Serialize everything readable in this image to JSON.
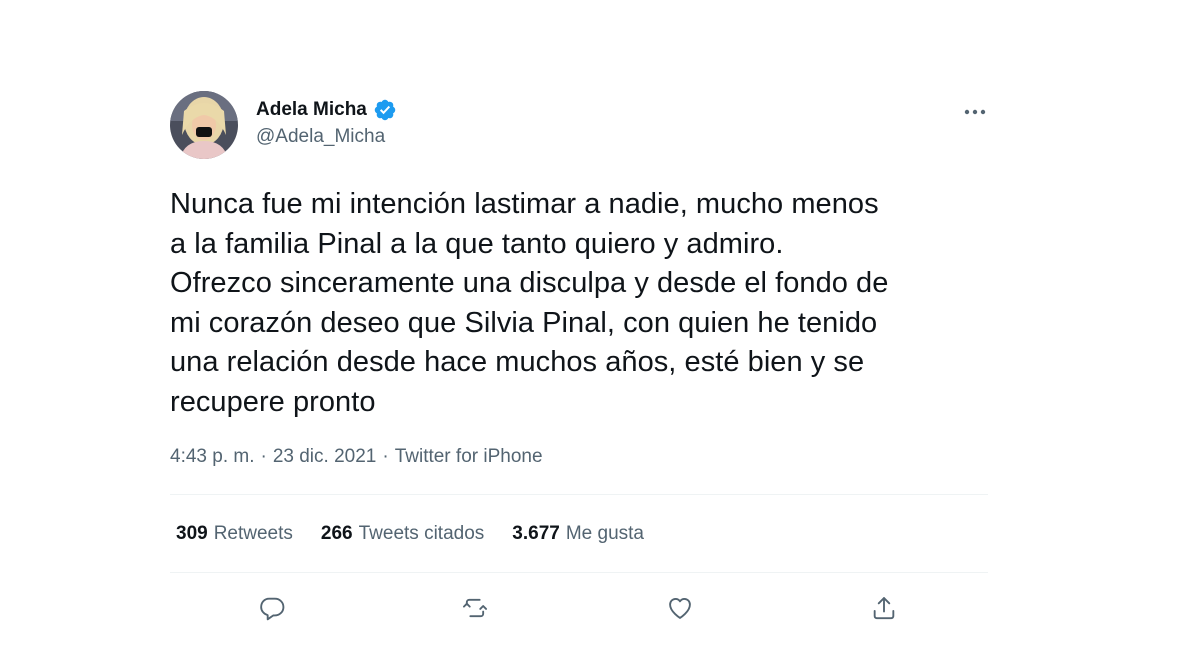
{
  "user": {
    "display_name": "Adela Micha",
    "handle": "@Adela_Micha",
    "verified": true,
    "avatar_icon": "user-avatar"
  },
  "tweet": {
    "text": "Nunca fue mi intención lastimar a nadie, mucho menos\na la familia Pinal a la que tanto quiero y admiro.\nOfrezco sinceramente una disculpa y desde el fondo de\nmi corazón deseo que Silvia Pinal, con quien he tenido\nuna relación desde hace muchos años, esté bien y se\nrecupere pronto",
    "time": "4:43 p. m.",
    "date": "23 dic. 2021",
    "source": "Twitter for iPhone",
    "separator": "·"
  },
  "stats": {
    "retweets_count": "309",
    "retweets_label": "Retweets",
    "quotes_count": "266",
    "quotes_label": "Tweets citados",
    "likes_count": "3.677",
    "likes_label": "Me gusta"
  },
  "actions": [
    "reply-icon",
    "retweet-icon",
    "like-icon",
    "share-icon"
  ],
  "colors": {
    "text": "#0f1419",
    "secondary": "#536471",
    "verified": "#1d9bf0",
    "divider": "#eff3f4"
  }
}
